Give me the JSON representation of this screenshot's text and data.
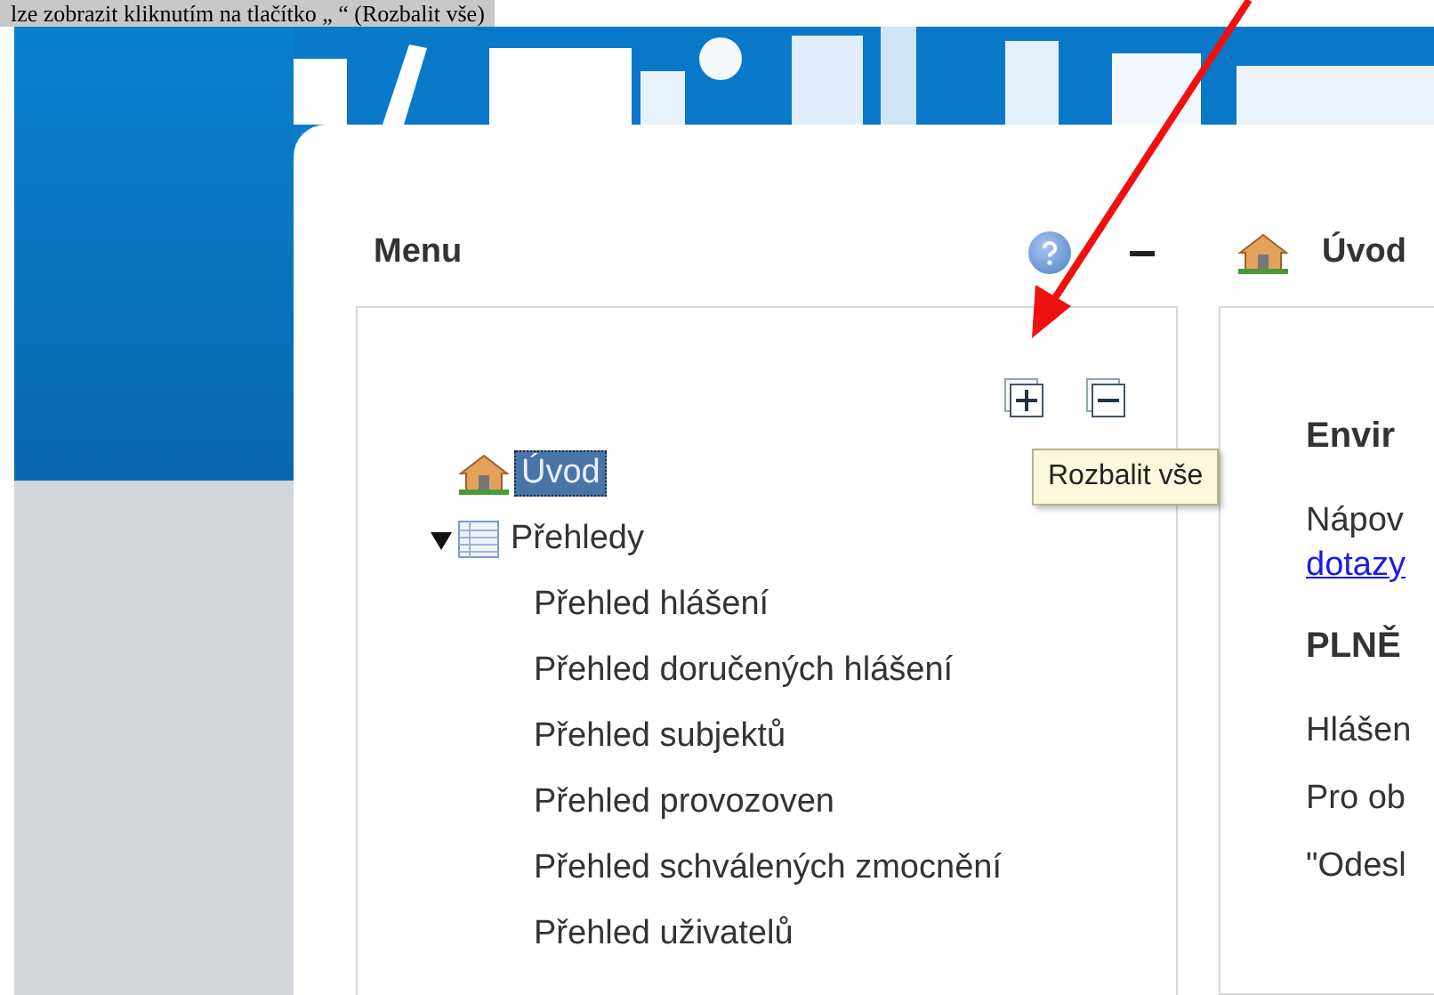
{
  "caption": "lze zobrazit kliknutím na tlačítko „ “ (Rozbalit vše)",
  "menu": {
    "title": "Menu",
    "tooltip": "Rozbalit vše",
    "tree": [
      {
        "label": "Úvod",
        "kind": "home",
        "selected": true
      },
      {
        "label": "Přehledy",
        "kind": "list",
        "selected": false,
        "expanded": true,
        "children": [
          {
            "label": "Přehled hlášení",
            "selected": false
          },
          {
            "label": "Přehled doručených hlášení",
            "selected": false
          },
          {
            "label": "Přehled subjektů",
            "selected": false
          },
          {
            "label": "Přehled provozoven",
            "selected": false
          },
          {
            "label": "Přehled schválených zmocnění",
            "selected": false
          },
          {
            "label": "Přehled uživatelů",
            "selected": false
          }
        ]
      }
    ]
  },
  "content": {
    "title": "Úvod",
    "blocks": [
      {
        "kind": "heading",
        "text": "Envir"
      },
      {
        "kind": "text",
        "text": "Nápov"
      },
      {
        "kind": "link",
        "text": "dotazy"
      },
      {
        "kind": "heading",
        "text": "PLNĚ"
      },
      {
        "kind": "text",
        "text": "Hlášen"
      },
      {
        "kind": "text",
        "text": "Pro ob"
      },
      {
        "kind": "text",
        "text": "\"Odesl"
      }
    ]
  }
}
